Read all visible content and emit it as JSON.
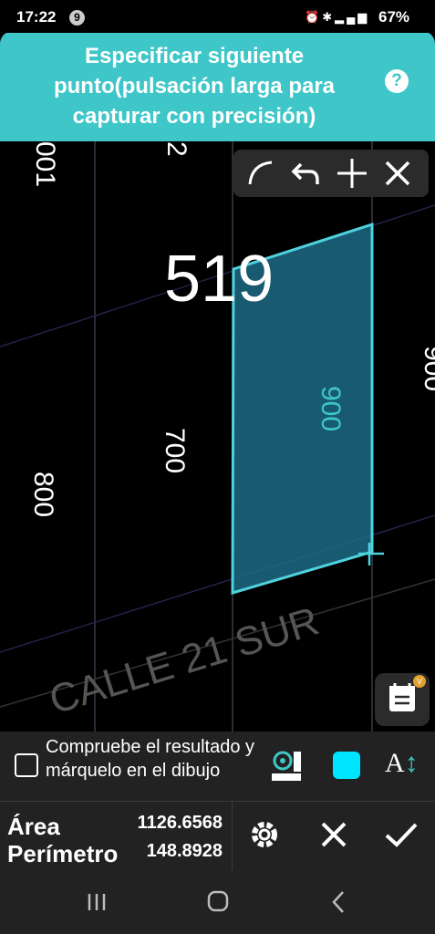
{
  "status_bar": {
    "time": "17:22",
    "notification_count": "9",
    "battery": "67%",
    "icons": [
      "alarm-icon",
      "bluetooth-icon",
      "network-4.5g-icon",
      "signal-icon",
      "battery-icon"
    ]
  },
  "banner": {
    "message": "Especificar siguiente punto(pulsación larga para capturar con precisión)",
    "help_icon": "?"
  },
  "drawing": {
    "parcel_number": "519",
    "labels": [
      "001",
      "2",
      "900",
      "700",
      "800",
      "900"
    ],
    "street_label": "CALLE 21 SUR",
    "fill_color": "#1c6b85",
    "outline_color": "#4fd1de"
  },
  "toolbar": {
    "buttons": [
      "arc-icon",
      "undo-icon",
      "add-point-icon",
      "close-icon"
    ]
  },
  "calendar_button": {
    "icon": "calendar-icon",
    "badge": "V"
  },
  "check_panel": {
    "checkbox_label": "Compruebe el resultado y márquelo en el dibujo",
    "tools": [
      "settings-ruler-icon",
      "color-swatch-icon",
      "text-size-icon"
    ],
    "swatch_color": "#00e5ff"
  },
  "results": {
    "area_label": "Área",
    "area_value": "1126.6568",
    "perimeter_label": "Perímetro",
    "perimeter_value": "148.8928",
    "actions": [
      "settings-icon",
      "cancel-icon",
      "confirm-icon"
    ]
  },
  "navbar": {
    "buttons": [
      "recent-apps-icon",
      "home-icon",
      "back-icon"
    ]
  }
}
